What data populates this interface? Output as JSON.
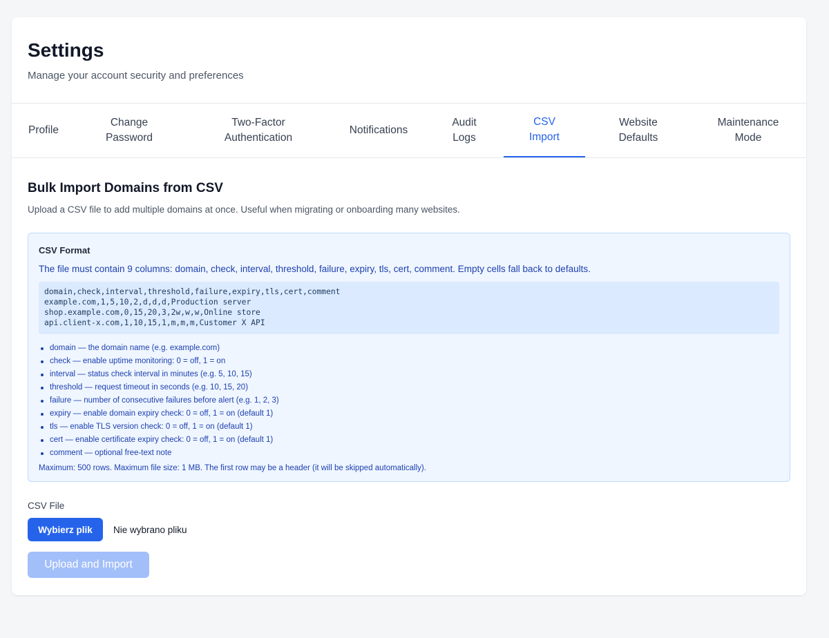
{
  "header": {
    "title": "Settings",
    "subtitle": "Manage your account security and preferences"
  },
  "tabs": [
    {
      "line1": "Profile",
      "line2": "",
      "active": false
    },
    {
      "line1": "Change",
      "line2": "Password",
      "active": false
    },
    {
      "line1": "Two-Factor",
      "line2": "Authentication",
      "active": false
    },
    {
      "line1": "Notifications",
      "line2": "",
      "active": false
    },
    {
      "line1": "Audit",
      "line2": "Logs",
      "active": false
    },
    {
      "line1": "CSV",
      "line2": "Import",
      "active": true
    },
    {
      "line1": "Website",
      "line2": "Defaults",
      "active": false
    },
    {
      "line1": "Maintenance",
      "line2": "Mode",
      "active": false
    }
  ],
  "section": {
    "title": "Bulk Import Domains from CSV",
    "description": "Upload a CSV file to add multiple domains at once. Useful when migrating or onboarding many websites."
  },
  "format": {
    "title": "CSV Format",
    "lead": "The file must contain 9 columns: domain, check, interval, threshold, failure, expiry, tls, cert, comment. Empty cells fall back to defaults.",
    "example": "domain,check,interval,threshold,failure,expiry,tls,cert,comment\nexample.com,1,5,10,2,d,d,d,Production server\nshop.example.com,0,15,20,3,2w,w,w,Online store\napi.client-x.com,1,10,15,1,m,m,m,Customer X API",
    "columns": [
      "domain — the domain name (e.g. example.com)",
      "check — enable uptime monitoring: 0 = off, 1 = on",
      "interval — status check interval in minutes (e.g. 5, 10, 15)",
      "threshold — request timeout in seconds (e.g. 10, 15, 20)",
      "failure — number of consecutive failures before alert (e.g. 1, 2, 3)",
      "expiry — enable domain expiry check: 0 = off, 1 = on (default 1)",
      "tls — enable TLS version check: 0 = off, 1 = on (default 1)",
      "cert — enable certificate expiry check: 0 = off, 1 = on (default 1)",
      "comment — optional free-text note"
    ],
    "note": "Maximum: 500 rows. Maximum file size: 1 MB. The first row may be a header (it will be skipped automatically)."
  },
  "upload": {
    "file_label": "CSV File",
    "choose_button": "Wybierz plik",
    "no_file_text": "Nie wybrano pliku",
    "submit_button": "Upload and Import"
  },
  "colors": {
    "accent": "#2563eb",
    "info_bg": "#eff6ff",
    "info_text": "#1e40af",
    "disabled_button": "#a3bffa"
  }
}
